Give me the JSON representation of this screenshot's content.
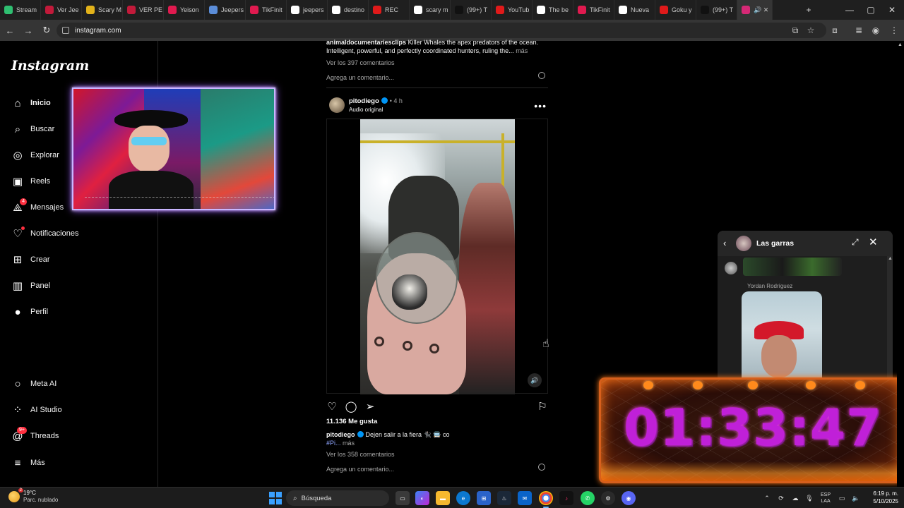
{
  "browser": {
    "tabs": [
      {
        "label": "Stream",
        "color": "#2fbf71"
      },
      {
        "label": "Ver Jee",
        "color": "#c21a3a"
      },
      {
        "label": "Scary M",
        "color": "#e2b21a"
      },
      {
        "label": "VER PE",
        "color": "#c21a3a"
      },
      {
        "label": "Yeison",
        "color": "#e01a4f"
      },
      {
        "label": "Jeepers",
        "color": "#5b8dd8"
      },
      {
        "label": "TikFinit",
        "color": "#e01a4f"
      },
      {
        "label": "jeepers",
        "color": "#ffffff"
      },
      {
        "label": "destino",
        "color": "#ffffff"
      },
      {
        "label": "REC",
        "color": "#e01a1a"
      },
      {
        "label": "scary m",
        "color": "#ffffff"
      },
      {
        "label": "(99+) T",
        "color": "#111111"
      },
      {
        "label": "YouTub",
        "color": "#e01a1a"
      },
      {
        "label": "The be",
        "color": "#ffffff"
      },
      {
        "label": "TikFinit",
        "color": "#e01a4f"
      },
      {
        "label": "Nueva",
        "color": "#ffffff"
      },
      {
        "label": "Goku y",
        "color": "#e01a1a"
      },
      {
        "label": "(99+) T",
        "color": "#111111"
      }
    ],
    "active_tab_color": "#d62976",
    "url": "instagram.com",
    "new_tab": "+",
    "minimize": "—",
    "maximize": "▢",
    "close": "✕"
  },
  "sidebar": {
    "logo": "Instagram",
    "items": [
      {
        "label": "Inicio",
        "icon": "⌂"
      },
      {
        "label": "Buscar",
        "icon": "⌕"
      },
      {
        "label": "Explorar",
        "icon": "◎"
      },
      {
        "label": "Reels",
        "icon": "▣"
      },
      {
        "label": "Mensajes",
        "icon": "⟁",
        "badge": "4"
      },
      {
        "label": "Notificaciones",
        "icon": "♡"
      },
      {
        "label": "Crear",
        "icon": "⊞"
      },
      {
        "label": "Panel",
        "icon": "▥"
      },
      {
        "label": "Perfil",
        "icon": "●"
      },
      {
        "label": "Meta AI",
        "icon": "○"
      },
      {
        "label": "AI Studio",
        "icon": "⁘"
      },
      {
        "label": "Threads",
        "icon": "@",
        "badge": "9+"
      },
      {
        "label": "Más",
        "icon": "≡"
      }
    ]
  },
  "feed": {
    "prev_post": {
      "username": "animaldocumentariesclips",
      "caption": "Killer Whales the apex predators of the ocean. Intelligent, powerful, and perfectly coordinated hunters, ruling the...",
      "more": "más",
      "comments": "Ver los 397 comentarios",
      "add_comment": "Agrega un comentario..."
    },
    "post": {
      "username": "pitodiego",
      "time": "• 4 h",
      "audio": "Audio original",
      "more_button": "•••",
      "likes": "11.136 Me gusta",
      "caption_text": "Dejen salir a la fiera 🐈‍⬛ 🚍 co",
      "hashtag": "#Pi...",
      "more": "más",
      "comments": "Ver los 358 comentarios",
      "add_comment": "Agrega un comentario..."
    }
  },
  "chat": {
    "title": "Las garras",
    "sender": "Yordan Rodríguez"
  },
  "timer": {
    "value": "01:33:47"
  },
  "taskbar": {
    "temperature": "19°C",
    "condition": "Parc. nublado",
    "weather_badge": "2",
    "search_placeholder": "Búsqueda",
    "lang_line1": "ESP",
    "lang_line2": "LAA",
    "time": "6:19 p. m.",
    "date": "5/10/2025"
  }
}
